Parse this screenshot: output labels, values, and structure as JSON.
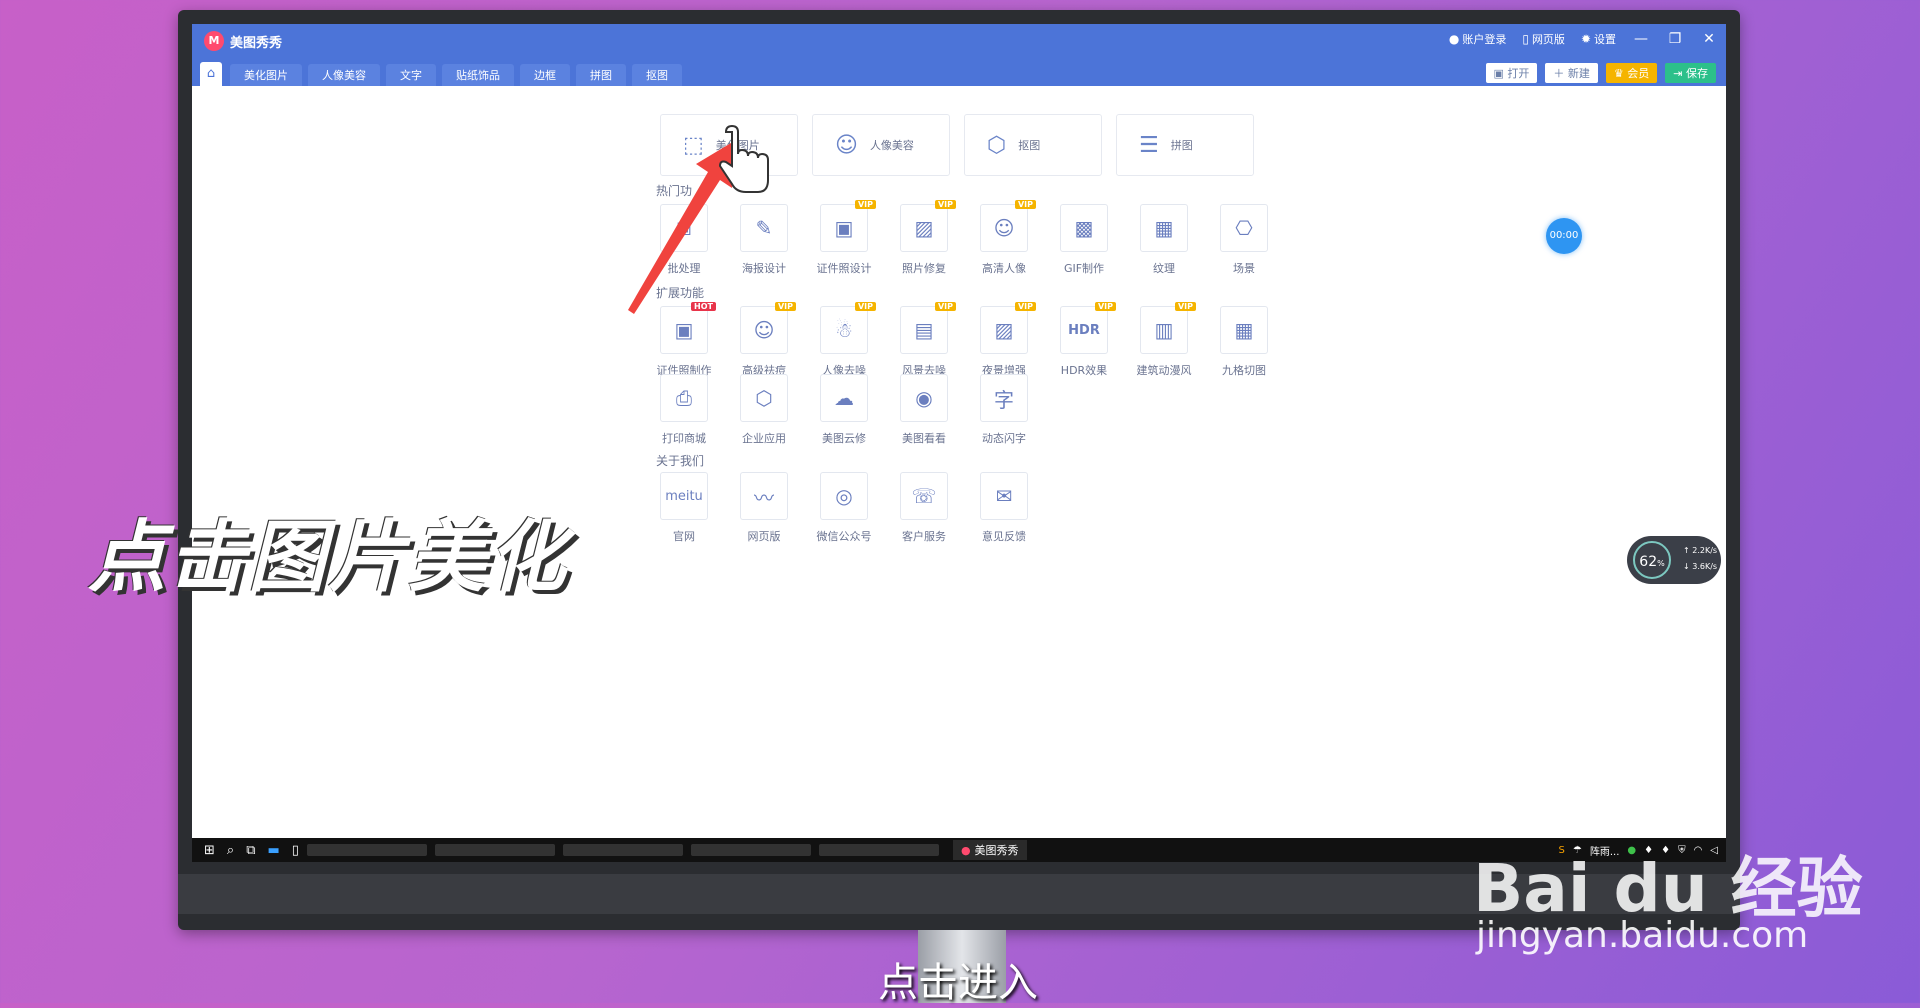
{
  "app": {
    "name": "美图秀秀",
    "top_links": [
      "账户登录",
      "网页版",
      "设置"
    ],
    "window_controls": [
      "—",
      "❐",
      "✕"
    ]
  },
  "nav": {
    "tabs": [
      "美化图片",
      "人像美容",
      "文字",
      "贴纸饰品",
      "边框",
      "拼图",
      "抠图"
    ],
    "actions": {
      "open": "打开",
      "new": "新建",
      "vip": "会员",
      "save": "保存"
    }
  },
  "cards": [
    {
      "label": "美化图片",
      "icon": "image-edit-icon"
    },
    {
      "label": "人像美容",
      "icon": "face-icon"
    },
    {
      "label": "抠图",
      "icon": "hexagon-icon"
    },
    {
      "label": "拼图",
      "icon": "collage-icon"
    }
  ],
  "sections": {
    "hot": "热门功",
    "extended": "扩展功能",
    "about": "关于我们"
  },
  "hot_tools": [
    {
      "label": "批处理",
      "badge": ""
    },
    {
      "label": "海报设计",
      "badge": ""
    },
    {
      "label": "证件照设计",
      "badge": "VIP"
    },
    {
      "label": "照片修复",
      "badge": "VIP"
    },
    {
      "label": "高清人像",
      "badge": "VIP"
    },
    {
      "label": "GIF制作",
      "badge": ""
    },
    {
      "label": "纹理",
      "badge": ""
    },
    {
      "label": "场景",
      "badge": ""
    }
  ],
  "ext_tools_row1": [
    {
      "label": "证件照制作",
      "badge": "HOT"
    },
    {
      "label": "高级祛痘",
      "badge": "VIP"
    },
    {
      "label": "人像去噪",
      "badge": "VIP"
    },
    {
      "label": "风景去噪",
      "badge": "VIP"
    },
    {
      "label": "夜景增强",
      "badge": "VIP"
    },
    {
      "label": "HDR效果",
      "badge": "VIP"
    },
    {
      "label": "建筑动漫风",
      "badge": "VIP"
    },
    {
      "label": "九格切图",
      "badge": ""
    }
  ],
  "ext_tools_row2": [
    {
      "label": "打印商城",
      "badge": ""
    },
    {
      "label": "企业应用",
      "badge": ""
    },
    {
      "label": "美图云修",
      "badge": ""
    },
    {
      "label": "美图看看",
      "badge": ""
    },
    {
      "label": "动态闪字",
      "badge": ""
    }
  ],
  "about_tools": [
    {
      "label": "官网",
      "icon_text": "meitu"
    },
    {
      "label": "网页版",
      "icon_text": ""
    },
    {
      "label": "微信公众号",
      "icon_text": ""
    },
    {
      "label": "客户服务",
      "icon_text": ""
    },
    {
      "label": "意见反馈",
      "icon_text": ""
    }
  ],
  "timer": "00:00",
  "net_monitor": {
    "percent": "62",
    "unit": "%",
    "up": "2.2",
    "down": "3.6",
    "rate_unit": "K/s"
  },
  "taskbar": {
    "app_label": "美图秀秀",
    "weather": "阵雨..."
  },
  "overlay": {
    "caption": "点击图片美化",
    "subtitle": "点击进入"
  },
  "watermark": {
    "logo": "Bai du 经验",
    "url": "jingyan.baidu.com"
  },
  "colors": {
    "brand": "#4c74d8",
    "vip": "#f5b400",
    "hot": "#e8344a",
    "save": "#2cc08a",
    "arrow": "#f0433e"
  }
}
